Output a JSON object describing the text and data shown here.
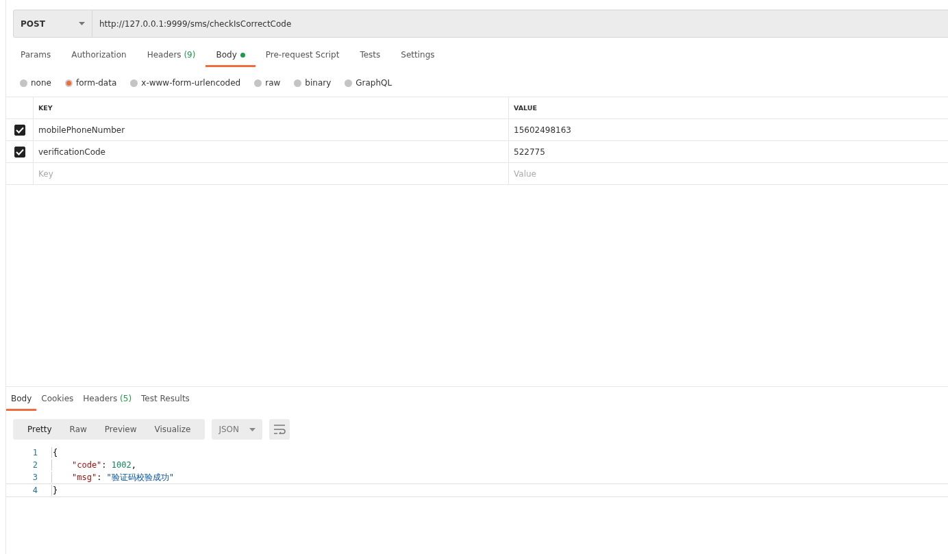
{
  "request": {
    "method": "POST",
    "url": "http://127.0.0.1:9999/sms/checkIsCorrectCode"
  },
  "request_tabs": [
    {
      "label": "Params",
      "selected": false
    },
    {
      "label": "Authorization",
      "selected": false
    },
    {
      "label": "Headers",
      "count": "(9)",
      "selected": false
    },
    {
      "label": "Body",
      "dot": true,
      "selected": true
    },
    {
      "label": "Pre-request Script",
      "selected": false
    },
    {
      "label": "Tests",
      "selected": false
    },
    {
      "label": "Settings",
      "selected": false
    }
  ],
  "body_types": [
    {
      "label": "none",
      "selected": false
    },
    {
      "label": "form-data",
      "selected": true
    },
    {
      "label": "x-www-form-urlencoded",
      "selected": false
    },
    {
      "label": "raw",
      "selected": false
    },
    {
      "label": "binary",
      "selected": false
    },
    {
      "label": "GraphQL",
      "selected": false
    }
  ],
  "params_table": {
    "columns": [
      "KEY",
      "VALUE"
    ],
    "rows": [
      {
        "key": "mobilePhoneNumber",
        "value": "15602498163",
        "checked": true
      },
      {
        "key": "verificationCode",
        "value": "522775",
        "checked": true
      }
    ],
    "new_row": {
      "key_placeholder": "Key",
      "value_placeholder": "Value"
    }
  },
  "response_tabs": [
    {
      "label": "Body",
      "selected": true
    },
    {
      "label": "Cookies",
      "selected": false
    },
    {
      "label": "Headers",
      "count": "(5)",
      "selected": false
    },
    {
      "label": "Test Results",
      "selected": false
    }
  ],
  "view_modes": [
    {
      "label": "Pretty",
      "selected": true
    },
    {
      "label": "Raw",
      "selected": false
    },
    {
      "label": "Preview",
      "selected": false
    },
    {
      "label": "Visualize",
      "selected": false
    }
  ],
  "format": "JSON",
  "code_lines": [
    {
      "number": "1",
      "tokens": [
        {
          "kind": "punct",
          "text": "{"
        }
      ]
    },
    {
      "number": "2",
      "indented": true,
      "tokens": [
        {
          "kind": "key",
          "text": "\"code\""
        },
        {
          "kind": "punct",
          "text": ": "
        },
        {
          "kind": "number",
          "text": "1002"
        },
        {
          "kind": "punct",
          "text": ","
        }
      ]
    },
    {
      "number": "3",
      "indented": true,
      "tokens": [
        {
          "kind": "key",
          "text": "\"msg\""
        },
        {
          "kind": "punct",
          "text": ": "
        },
        {
          "kind": "string",
          "text": "\"验证码校验成功\""
        }
      ]
    },
    {
      "number": "4",
      "tokens": [
        {
          "kind": "punct",
          "text": "}"
        }
      ],
      "current": true
    }
  ]
}
